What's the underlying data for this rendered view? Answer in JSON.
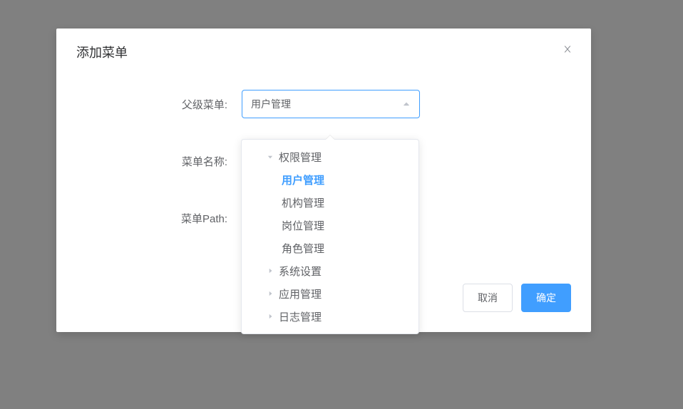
{
  "modal": {
    "title": "添加菜单",
    "close_icon": "close"
  },
  "form": {
    "parent_menu": {
      "label": "父级菜单:",
      "value": "用户管理"
    },
    "menu_name": {
      "label": "菜单名称:",
      "value": ""
    },
    "menu_path": {
      "label": "菜单Path:",
      "value": ""
    }
  },
  "footer": {
    "cancel": "取消",
    "confirm": "确定"
  },
  "dropdown": {
    "nodes": [
      {
        "label": "权限管理",
        "level": 1,
        "expanded": true,
        "has_children": true,
        "selected": false
      },
      {
        "label": "用户管理",
        "level": 2,
        "expanded": false,
        "has_children": false,
        "selected": true
      },
      {
        "label": "机构管理",
        "level": 2,
        "expanded": false,
        "has_children": false,
        "selected": false
      },
      {
        "label": "岗位管理",
        "level": 2,
        "expanded": false,
        "has_children": false,
        "selected": false
      },
      {
        "label": "角色管理",
        "level": 2,
        "expanded": false,
        "has_children": false,
        "selected": false
      },
      {
        "label": "系统设置",
        "level": 1,
        "expanded": false,
        "has_children": true,
        "selected": false
      },
      {
        "label": "应用管理",
        "level": 1,
        "expanded": false,
        "has_children": true,
        "selected": false
      },
      {
        "label": "日志管理",
        "level": 1,
        "expanded": false,
        "has_children": true,
        "selected": false
      }
    ]
  }
}
